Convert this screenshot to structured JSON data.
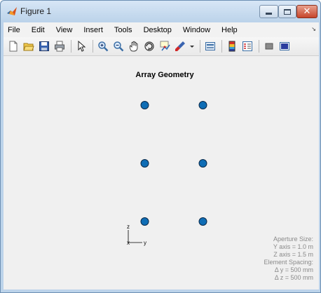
{
  "window": {
    "title": "Figure 1",
    "close_glyph": "✕"
  },
  "menu": [
    "File",
    "Edit",
    "View",
    "Insert",
    "Tools",
    "Desktop",
    "Window",
    "Help"
  ],
  "menu_overflow": "↘",
  "toolbar": [
    "new-figure-icon",
    "open-file-icon",
    "save-icon",
    "print-icon",
    "sep",
    "pointer-icon",
    "sep",
    "zoom-in-icon",
    "zoom-out-icon",
    "pan-icon",
    "rotate-3d-icon",
    "data-cursor-icon",
    "brush-icon",
    "brush-dropdown-icon",
    "sep",
    "link-plot-icon",
    "sep",
    "colorbar-icon",
    "legend-icon",
    "sep",
    "hide-plot-tools-icon",
    "show-plot-tools-icon"
  ],
  "figure": {
    "title": "Array Geometry",
    "axis_labels": {
      "z": "z",
      "x": "x",
      "y": "y"
    },
    "info": {
      "aperture_heading": "Aperture Size:",
      "y_axis": "Y axis = 1.0 m",
      "z_axis": "Z axis = 1.5 m",
      "spacing_heading": "Element Spacing:",
      "delta_y": "Δ y = 500 mm",
      "delta_z": "Δ z = 500 mm"
    },
    "elements": [
      {
        "y": -0.25,
        "z": 0.5
      },
      {
        "y": 0.25,
        "z": 0.5
      },
      {
        "y": -0.25,
        "z": 0.0
      },
      {
        "y": 0.25,
        "z": 0.0
      },
      {
        "y": -0.25,
        "z": -0.5
      },
      {
        "y": 0.25,
        "z": -0.5
      }
    ],
    "marker_color": "#0f6db5",
    "marker_edge": "#0a2a4a"
  }
}
